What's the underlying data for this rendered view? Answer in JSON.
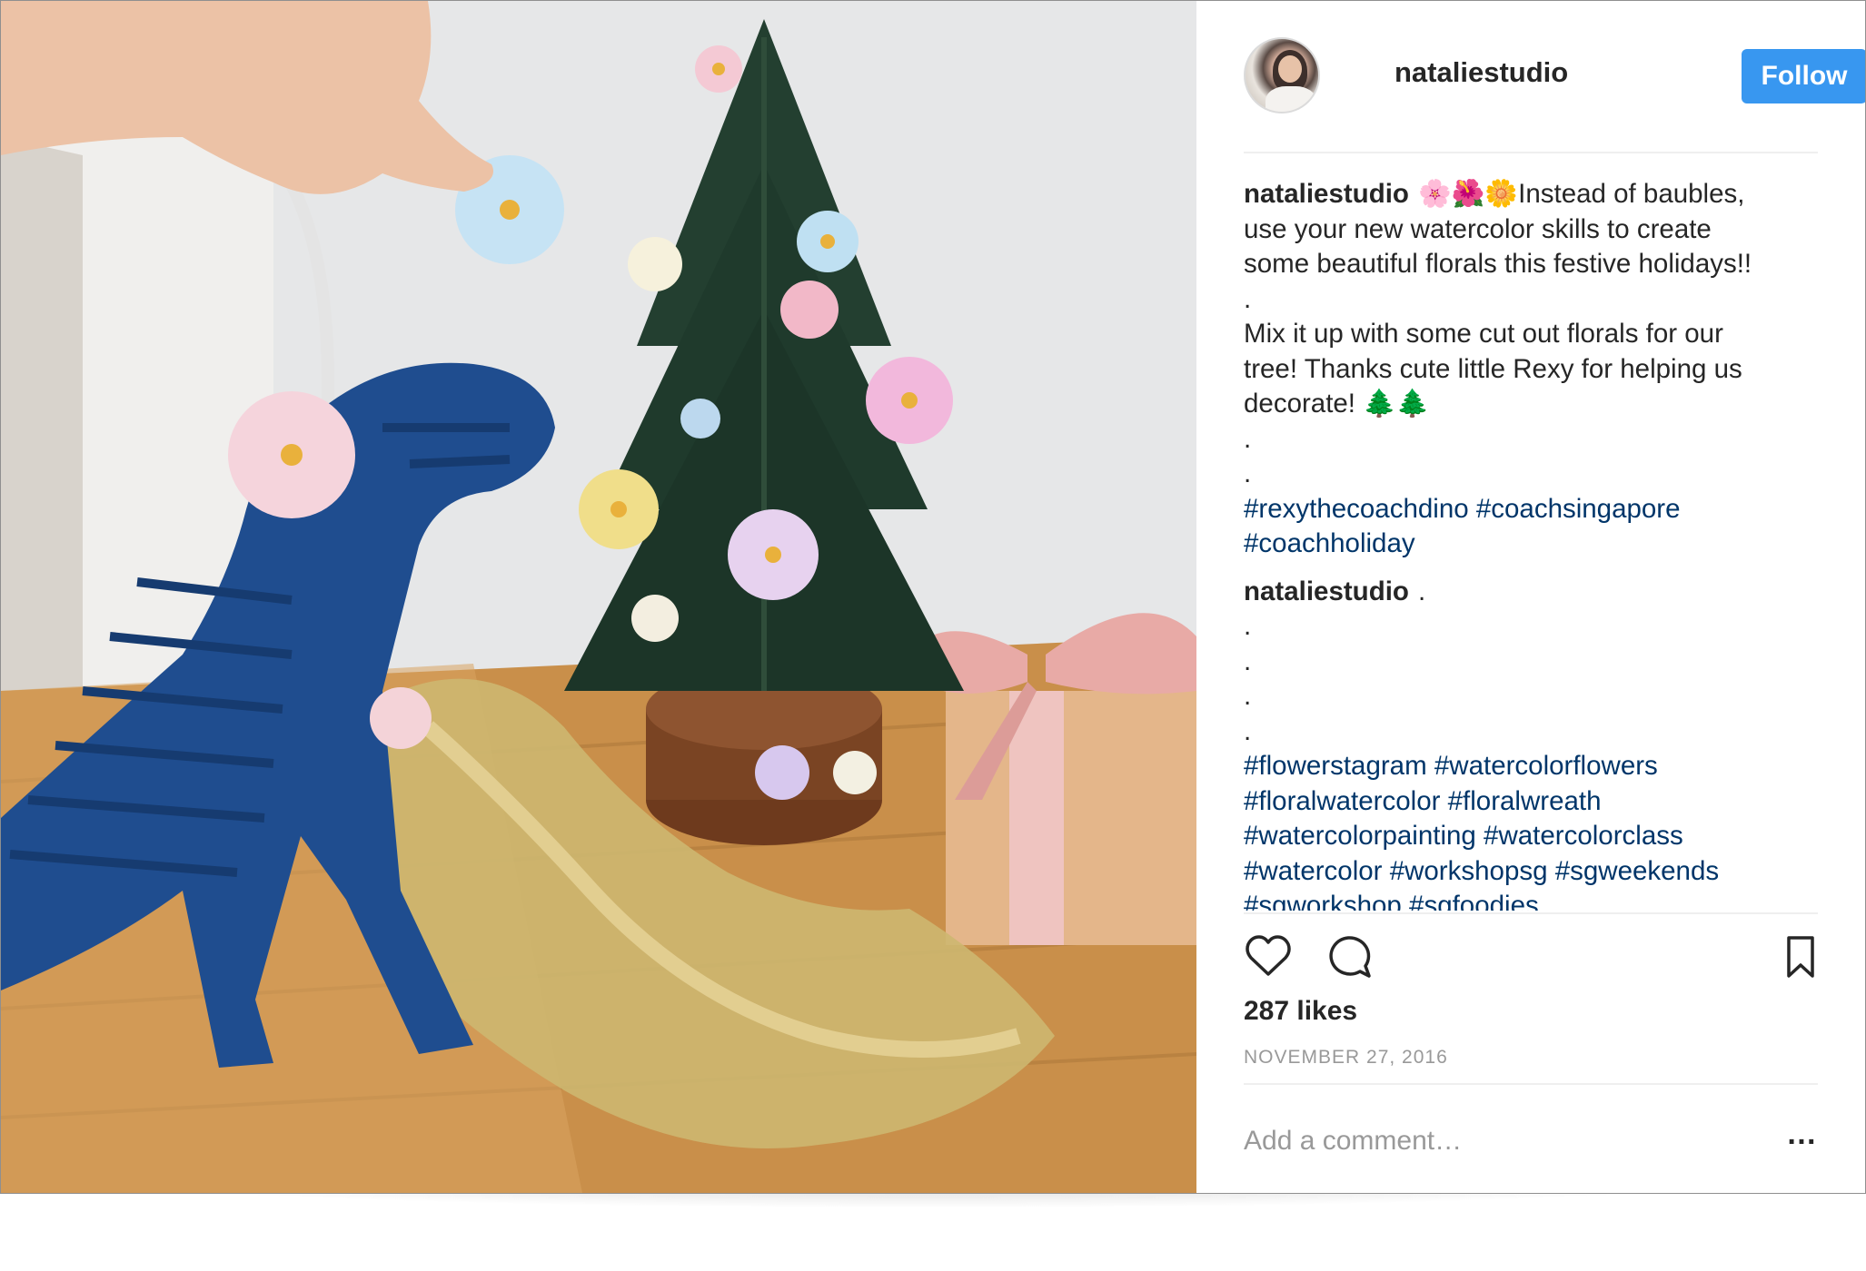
{
  "post": {
    "username": "nataliestudio",
    "follow_label": "Follow",
    "caption": {
      "user": "nataliestudio",
      "emoji": "🌸🌺🌼",
      "lines": [
        "Instead of baubles,",
        "use your new watercolor skills to create",
        "some beautiful florals this festive holidays!!"
      ],
      "dot1": ".",
      "body2": [
        "Mix it up with some cut out florals for our",
        "tree! Thanks cute little Rexy for helping us",
        "decorate! 🌲🌲"
      ],
      "dots": [
        ".",
        "."
      ],
      "hashtags": [
        "#rexythecoachdino",
        "#coachsingapore",
        "#coachholiday"
      ]
    },
    "second_comment": {
      "user": "nataliestudio",
      "text": ".",
      "dots": [
        ".",
        ".",
        ".",
        "."
      ],
      "hashtags": [
        "#flowerstagram",
        "#watercolorflowers",
        "#floralwatercolor",
        "#floralwreath",
        "#watercolorpainting",
        "#watercolorclass",
        "#watercolor",
        "#workshopsg",
        "#sgweekends",
        "#sgworkshop",
        "#sgfoodies"
      ]
    },
    "likes": "287 likes",
    "date": "NOVEMBER 27, 2016",
    "comment_placeholder": "Add a comment…",
    "more_label": "…",
    "icons": [
      "heart-icon",
      "comment-icon",
      "bookmark-icon",
      "more-icon"
    ],
    "colors": {
      "follow_button": "#3897f0",
      "hashtag": "#003569",
      "text": "#262626",
      "muted": "#999999",
      "divider": "#efefef"
    }
  }
}
